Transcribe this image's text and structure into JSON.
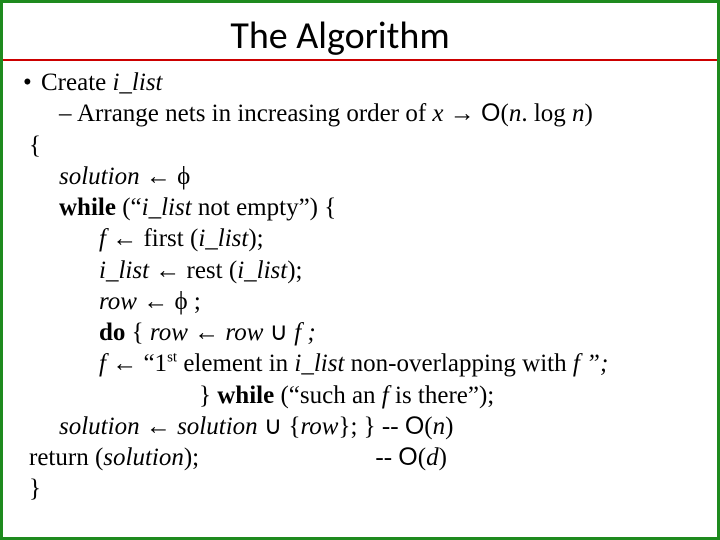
{
  "title": "The Algorithm",
  "bullet_create": "Create ",
  "ilist": "i_list",
  "bullet_arrange_pre": "Arrange nets in increasing order of ",
  "x": "x",
  "arrow_big": " → ",
  "O": "O",
  "arrange_complexity_open": "(",
  "n": "n",
  "dot_log": ". log ",
  "arrange_close": ")",
  "lbrace": "{",
  "solution": "solution",
  "assign": " ← ",
  "phi": "ϕ",
  "while": "while",
  "while_cond_open": " (“",
  "while_cond_mid": "  not empty”) {",
  "f": "f",
  "first": " first (",
  "rparen_semi": ");",
  "rest": " rest (",
  "row": "row",
  "phi_semi": "ϕ ;",
  "do": "do",
  "do_open": " { ",
  "union": " ∪ ",
  "f_semi": "f ;",
  "first_elem_open": " “1",
  "st": "st",
  "first_elem_mid": " element in ",
  "first_elem_end": " non-overlapping with ",
  "f_close": "f ”;",
  "endwhile_open": "} ",
  "endwhile_cond": " (“such an ",
  "endwhile_end": " is there”);",
  "row_braces_open": "{",
  "row_braces_close": "}",
  "dashdash": " -- ",
  "On": "(",
  "n_paren": ")",
  "return": "return (",
  "return_close": ");",
  "Od_open": "(",
  "d": "d",
  "Od_close": ")",
  "rbrace": "}",
  "semicolon_brace": "; }"
}
